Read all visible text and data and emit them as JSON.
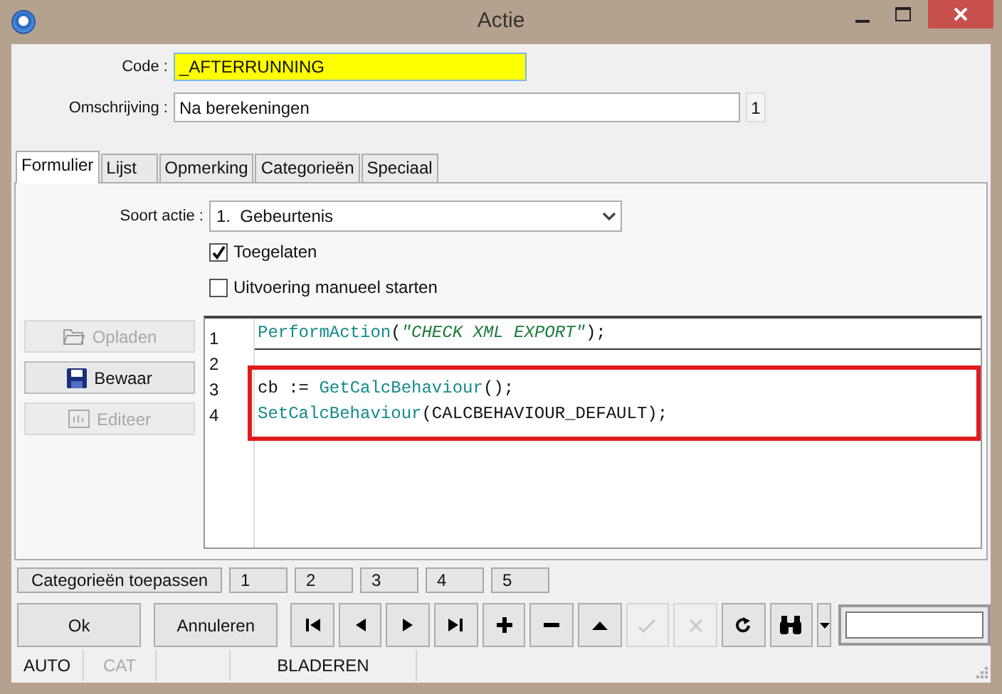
{
  "window": {
    "title": "Actie"
  },
  "code": {
    "label": "Code :",
    "value": "_AFTERRUNNING"
  },
  "description": {
    "label": "Omschrijving :",
    "value": "Na berekeningen",
    "counter": "1"
  },
  "tabs": [
    {
      "label": "Formulier",
      "selected": true
    },
    {
      "label": "Lijst",
      "selected": false
    },
    {
      "label": "Opmerking",
      "selected": false
    },
    {
      "label": "Categorieën",
      "selected": false
    },
    {
      "label": "Speciaal",
      "selected": false
    }
  ],
  "action_type": {
    "label": "Soort actie :",
    "value": "1.  Gebeurtenis"
  },
  "checkboxes": [
    {
      "label": "Toegelaten",
      "checked": true
    },
    {
      "label": "Uitvoering manueel starten",
      "checked": false
    }
  ],
  "side_buttons": [
    {
      "kind": "upload",
      "label": "Opladen",
      "disabled": true
    },
    {
      "kind": "save",
      "label": "Bewaar",
      "disabled": false
    },
    {
      "kind": "edit",
      "label": "Editeer",
      "disabled": true
    }
  ],
  "editor": {
    "lines": [
      {
        "number": "1",
        "current": true,
        "annotated": false,
        "tokens": [
          {
            "kind": "function",
            "text": "PerformAction"
          },
          {
            "kind": "plain",
            "text": "("
          },
          {
            "kind": "string",
            "text": "\"CHECK XML EXPORT\""
          },
          {
            "kind": "plain",
            "text": ");"
          }
        ]
      },
      {
        "number": "2",
        "current": false,
        "annotated": false
      },
      {
        "number": "3",
        "current": false,
        "annotated": true,
        "tokens": [
          {
            "kind": "plain",
            "text": "cb := "
          },
          {
            "kind": "function",
            "text": "GetCalcBehaviour"
          },
          {
            "kind": "plain",
            "text": "();"
          }
        ]
      },
      {
        "number": "4",
        "current": false,
        "annotated": true,
        "tokens": [
          {
            "kind": "function",
            "text": "SetCalcBehaviour"
          },
          {
            "kind": "plain",
            "text": "(CALCBEHAVIOUR_DEFAULT);"
          }
        ]
      }
    ]
  },
  "category_bar": {
    "apply": "Categorieën toepassen",
    "slots": [
      "1",
      "2",
      "3",
      "4",
      "5"
    ]
  },
  "buttons": [
    {
      "label": "Ok"
    },
    {
      "label": "Annuleren"
    }
  ],
  "nav_buttons": [
    {
      "kind": "first",
      "disabled": false
    },
    {
      "kind": "prev",
      "disabled": false
    },
    {
      "kind": "next",
      "disabled": false
    },
    {
      "kind": "last",
      "disabled": false
    },
    {
      "kind": "add",
      "disabled": false
    },
    {
      "kind": "remove",
      "disabled": false
    },
    {
      "kind": "up",
      "disabled": false
    },
    {
      "kind": "confirm",
      "disabled": true
    },
    {
      "kind": "cancel",
      "disabled": true
    },
    {
      "kind": "refresh",
      "disabled": false
    },
    {
      "kind": "find",
      "disabled": false
    }
  ],
  "status_bar": [
    {
      "text": "AUTO",
      "disabled": false
    },
    {
      "text": "CAT",
      "disabled": true
    },
    {
      "text": "BLADEREN",
      "disabled": false
    }
  ]
}
